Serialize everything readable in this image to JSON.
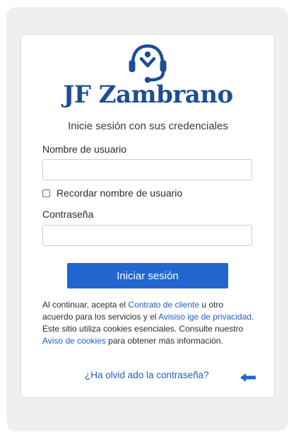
{
  "brand": {
    "name": "JF Zambrano",
    "color": "#1d4e93",
    "logo_icon": "headset-support-icon"
  },
  "login": {
    "subtitle": "Inicie sesión con sus credenciales",
    "username_label": "Nombre de usuario",
    "username_value": "",
    "remember_label": "Recordar nombre de usuario",
    "remember_checked": false,
    "password_label": "Contraseña",
    "password_value": "",
    "submit_label": "Iniciar sesión",
    "accent_color": "#2266d0"
  },
  "legal": {
    "text_1": "Al continuar, acepta el ",
    "link_contract": "Contrato de cliente",
    "text_2": " u otro acuerdo para los servicios y el ",
    "link_privacy": "Avisiso ige de privacidad",
    "text_3": ". Este sitio utiliza cookies esenciales. Consulte nuestro ",
    "link_cookies": "Aviso de cookies",
    "text_4": " para obtener más información."
  },
  "forgot_password": {
    "label": "¿Ha olvid ado la contraseña?",
    "arrow_icon": "arrow-left-icon"
  }
}
